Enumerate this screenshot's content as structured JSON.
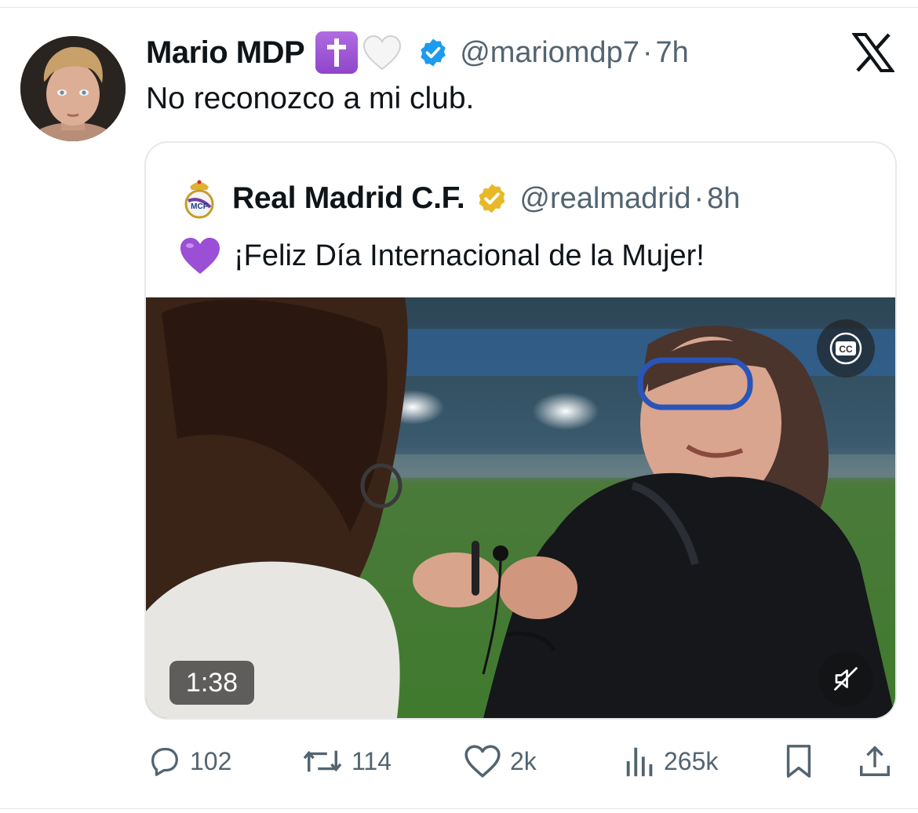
{
  "tweet": {
    "author_name": "Mario MDP",
    "author_handle": "@mariomdp7",
    "separator": "·",
    "time": "7h",
    "text": "No reconozco a mi club."
  },
  "quoted_tweet": {
    "author_name": "Real Madrid C.F.",
    "author_handle": "@realmadrid",
    "separator": "·",
    "time": "8h",
    "text": "¡Feliz Día Internacional de la Mujer!",
    "video": {
      "duration": "1:38",
      "muted": true
    }
  },
  "actions": {
    "replies": "102",
    "reposts": "114",
    "likes": "2k",
    "views": "265k"
  },
  "colors": {
    "verified_blue": "#1d9bf0",
    "verified_gold": "#e8b829",
    "muted_text": "#536471",
    "border": "#e7e9ea",
    "purple": "#9b4fd6"
  },
  "icons": [
    "latin-cross-emoji",
    "white-heart-emoji",
    "verified-badge-icon",
    "x-logo-icon",
    "real-madrid-crest-icon",
    "gold-verified-badge-icon",
    "purple-heart-emoji",
    "closed-captions-icon",
    "muted-speaker-icon",
    "reply-icon",
    "repost-icon",
    "like-icon",
    "views-icon",
    "bookmark-icon",
    "share-icon"
  ]
}
